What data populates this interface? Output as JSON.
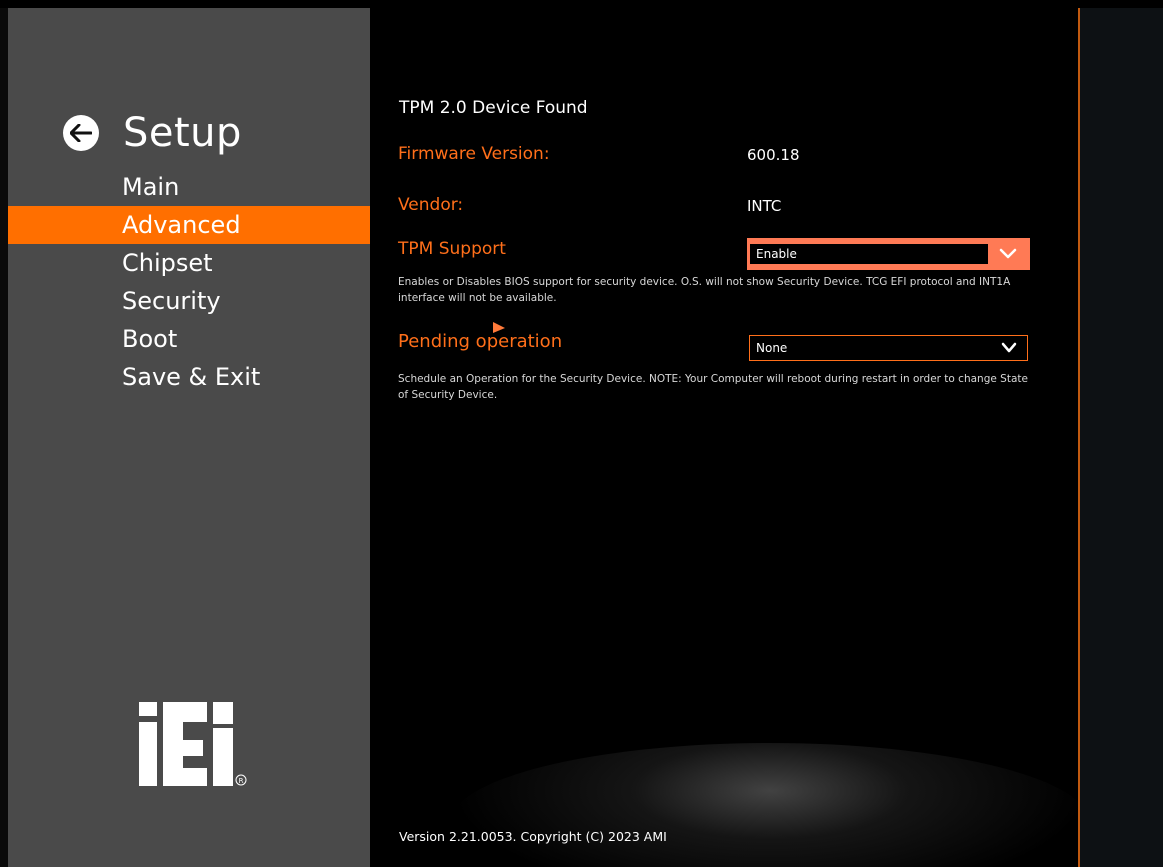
{
  "sidebar": {
    "title": "Setup",
    "items": [
      {
        "label": "Main",
        "active": false
      },
      {
        "label": "Advanced",
        "active": true
      },
      {
        "label": "Chipset",
        "active": false
      },
      {
        "label": "Security",
        "active": false
      },
      {
        "label": "Boot",
        "active": false
      },
      {
        "label": "Save & Exit",
        "active": false
      }
    ],
    "logo_text": "iEi",
    "logo_mark": "®"
  },
  "main": {
    "header": "TPM 2.0 Device Found",
    "firmware": {
      "label": "Firmware Version:",
      "value": "600.18"
    },
    "vendor": {
      "label": "Vendor:",
      "value": "INTC"
    },
    "tpm_support": {
      "label": "TPM Support",
      "value": "Enable",
      "help": "Enables or Disables BIOS support for security device. O.S. will not show Security Device. TCG EFI protocol and INT1A interface will not be available."
    },
    "pending": {
      "label": "Pending operation",
      "value": "None",
      "help": "Schedule an Operation for the Security Device. NOTE: Your Computer will reboot during restart in order to change State of Security Device."
    },
    "version": "Version 2.21.0053. Copyright (C) 2023 AMI"
  },
  "colors": {
    "accent": "#ff6f00",
    "label_orange": "#ff6f1a",
    "sidebar_bg": "#4a4a4a",
    "main_bg": "#000000"
  },
  "icons": [
    "back-arrow-icon",
    "chevron-down-icon",
    "mouse-cursor-icon",
    "iei-logo"
  ]
}
